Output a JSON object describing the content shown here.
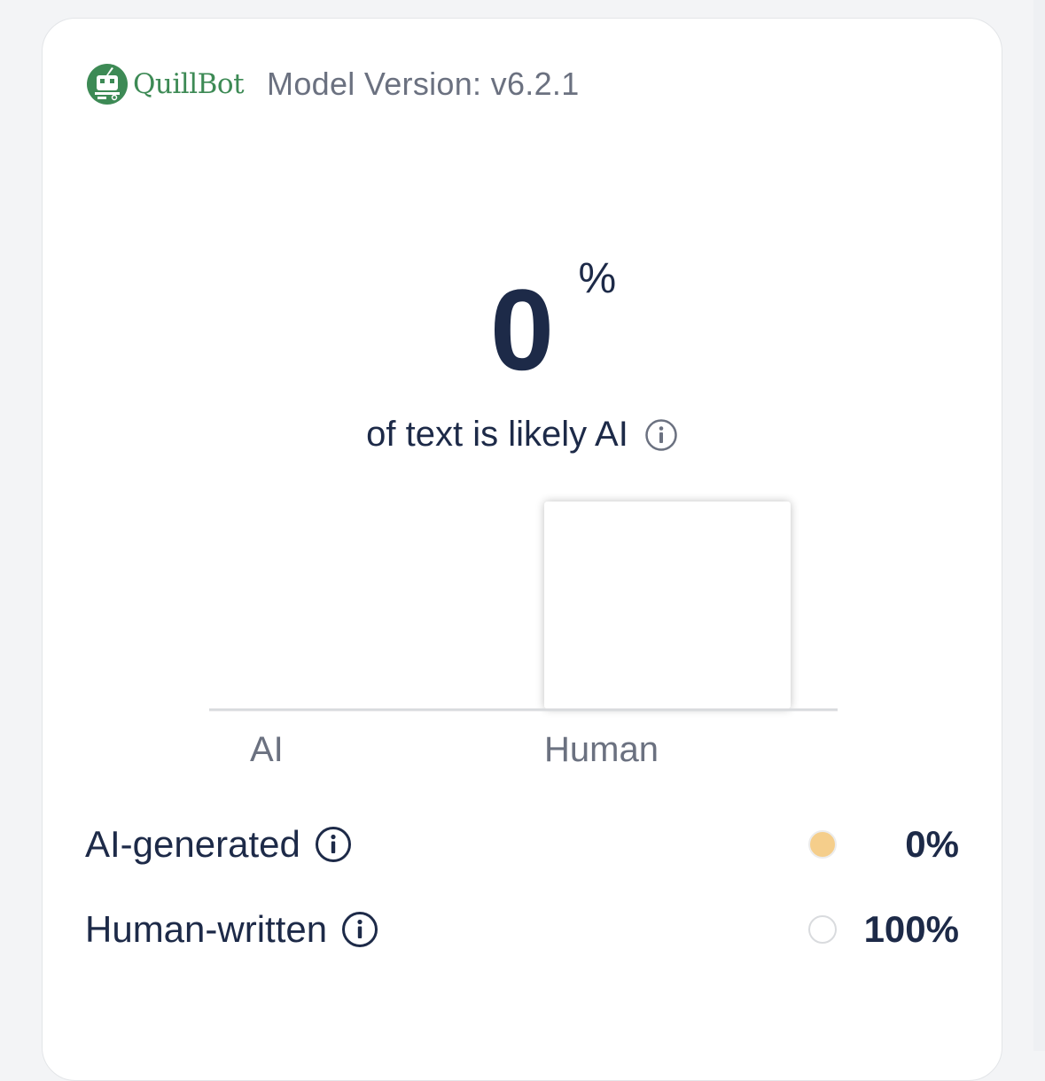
{
  "header": {
    "brand": "QuillBot",
    "model_version": "Model Version: v6.2.1"
  },
  "result": {
    "score": "0",
    "unit": "%",
    "caption": "of text is likely AI"
  },
  "chart_data": {
    "type": "bar",
    "categories": [
      "AI",
      "Human"
    ],
    "values": [
      0,
      100
    ],
    "ylim": [
      0,
      100
    ],
    "grid": false
  },
  "breakdown": [
    {
      "label": "AI-generated",
      "percent": "0%",
      "color": "#f5ce8b"
    },
    {
      "label": "Human-written",
      "percent": "100%",
      "color": "#ffffff"
    }
  ],
  "icons": {
    "info": "info-icon",
    "logo": "quillbot-logo-icon"
  }
}
